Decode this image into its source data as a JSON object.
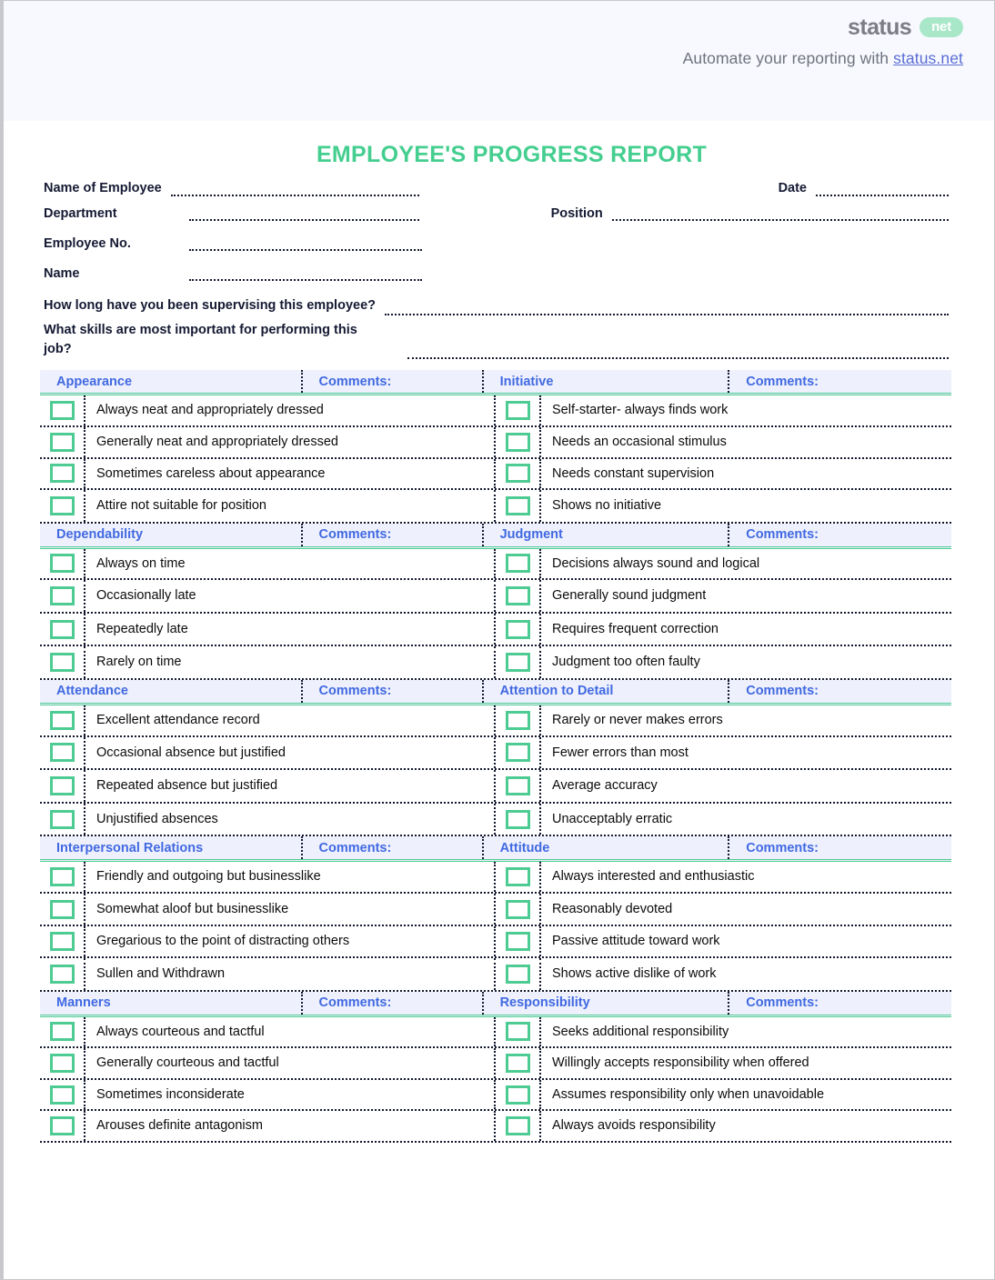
{
  "brand": {
    "word": "status",
    "pill": "net",
    "tagline_prefix": "Automate your reporting with ",
    "tagline_link": "status.net"
  },
  "title": "EMPLOYEE'S PROGRESS REPORT",
  "colors": {
    "title_green": "#44ce8f",
    "header_blue": "#4169e1",
    "header_bg": "#eef1fd",
    "checkbox_green": "#4ecb93",
    "banner_bg": "#f7f9fe",
    "link_blue": "#5b6dd6"
  },
  "fields": {
    "name_of_employee": "Name of Employee",
    "date": "Date",
    "department": "Department",
    "position": "Position",
    "employee_no": "Employee No.",
    "name": "Name",
    "q_supervising": "How long have you been supervising this employee?",
    "q_skills_line1": "What skills are most important for performing this",
    "q_skills_line2": "job?"
  },
  "comments_label": "Comments:",
  "sections": [
    {
      "left_title": "Appearance",
      "right_title": "Initiative",
      "left_items": [
        "Always neat and appropriately dressed",
        "Generally neat and appropriately dressed",
        "Sometimes careless about appearance",
        "Attire not suitable for position"
      ],
      "right_items": [
        "Self-starter- always finds work",
        "Needs an occasional stimulus",
        "Needs constant supervision",
        "Shows no initiative"
      ]
    },
    {
      "left_title": "Dependability",
      "right_title": "Judgment",
      "left_items": [
        "Always on time",
        "Occasionally late",
        "Repeatedly late",
        "Rarely on time"
      ],
      "right_items": [
        "Decisions always sound and  logical",
        "Generally sound judgment",
        "Requires frequent correction",
        "Judgment too often faulty"
      ]
    },
    {
      "left_title": "Attendance",
      "right_title": "Attention to Detail",
      "left_items": [
        "Excellent attendance record",
        "Occasional absence but justified",
        "Repeated absence but justified",
        "Unjustified absences"
      ],
      "right_items": [
        "Rarely or never makes errors",
        "Fewer errors than most",
        "Average accuracy",
        "Unacceptably erratic"
      ]
    },
    {
      "left_title": "Interpersonal Relations",
      "right_title": "Attitude",
      "left_items": [
        "Friendly and outgoing but businesslike",
        "Somewhat aloof but businesslike",
        "Gregarious to the point of distracting others",
        "Sullen and Withdrawn"
      ],
      "right_items": [
        "Always interested and  enthusiastic",
        "Reasonably devoted",
        "Passive attitude toward work",
        "Shows active dislike of work"
      ]
    },
    {
      "left_title": "Manners",
      "right_title": "Responsibility",
      "left_items": [
        "Always courteous and tactful",
        "Generally courteous and tactful",
        "Sometimes inconsiderate",
        "Arouses definite antagonism"
      ],
      "right_items": [
        "Seeks  additional responsibility",
        "Willingly accepts responsibility when offered",
        "Assumes responsibility only when unavoidable",
        "Always avoids responsibility"
      ]
    }
  ]
}
